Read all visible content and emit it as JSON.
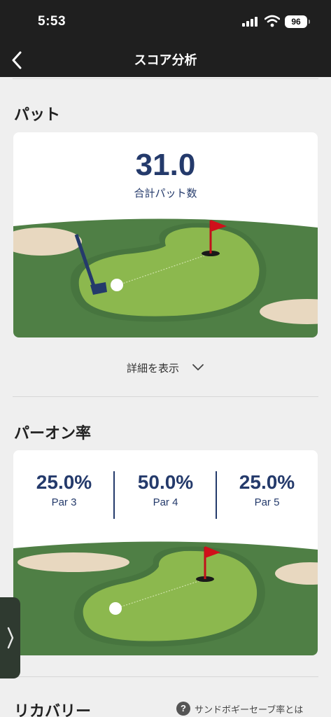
{
  "status_bar": {
    "time": "5:53",
    "battery": "96",
    "icons": [
      "signal-icon",
      "wifi-icon",
      "battery-icon"
    ]
  },
  "nav": {
    "title": "スコア分析",
    "back_icon": "chevron-left-icon"
  },
  "putts": {
    "section_title": "パット",
    "value": "31.0",
    "label": "合計パット数",
    "details_label": "詳細を表示",
    "details_icon": "chevron-down-icon"
  },
  "gir": {
    "section_title": "パーオン率",
    "stats": [
      {
        "value": "25.0%",
        "label": "Par 3"
      },
      {
        "value": "50.0%",
        "label": "Par 4"
      },
      {
        "value": "25.0%",
        "label": "Par 5"
      }
    ]
  },
  "recovery": {
    "section_title": "リカバリー",
    "help_label": "サンドボギーセーブ率とは",
    "help_icon": "question-icon"
  },
  "side_tab_icon": "chevron-right-icon",
  "colors": {
    "header_bg": "#1f1f1f",
    "value_navy": "#243a6b",
    "fairway": "#4f7f45",
    "green": "#8cb84e",
    "flag": "#d0101a",
    "sand": "#e8d8c0"
  }
}
